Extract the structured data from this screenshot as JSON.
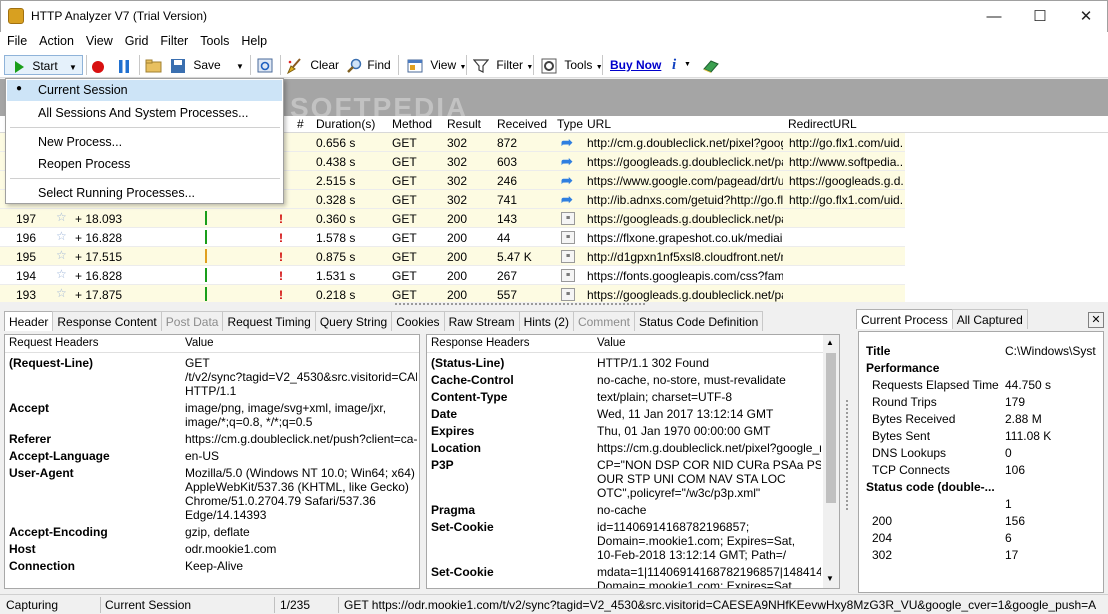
{
  "window": {
    "title": "HTTP Analyzer V7  (Trial Version)"
  },
  "menu": [
    "File",
    "Action",
    "View",
    "Grid",
    "Filter",
    "Tools",
    "Help"
  ],
  "toolbar": {
    "start": "Start",
    "save": "Save",
    "clear": "Clear",
    "find": "Find",
    "view": "View",
    "filter": "Filter",
    "tools": "Tools",
    "buy_now": "Buy Now"
  },
  "watermark": "SOFTPEDIA",
  "start_menu": {
    "items": [
      "Current Session",
      "All Sessions And System Processes...",
      "New Process...",
      "Reopen Process",
      "Select Running Processes..."
    ],
    "selected": "Current Session"
  },
  "grid": {
    "columns": [
      "#",
      "Duration(s)",
      "Method",
      "Result",
      "Received",
      "Type",
      "URL",
      "RedirectURL"
    ],
    "rows": [
      {
        "id": "",
        "offset": "",
        "duration": "0.656 s",
        "method": "GET",
        "result": "302",
        "received": "872",
        "url": "http://cm.g.doubleclick.net/pixel?googl...",
        "redirect": "http://go.flx1.com/uid..."
      },
      {
        "id": "",
        "offset": "",
        "duration": "0.438 s",
        "method": "GET",
        "result": "302",
        "received": "603",
        "url": "https://googleads.g.doubleclick.net/pa...",
        "redirect": "http://www.softpedia...."
      },
      {
        "id": "",
        "offset": "",
        "duration": "2.515 s",
        "method": "GET",
        "result": "302",
        "received": "246",
        "url": "https://www.google.com/pagead/drt/ui",
        "redirect": "https://googleads.g.d..."
      },
      {
        "id": "",
        "offset": "",
        "duration": "0.328 s",
        "method": "GET",
        "result": "302",
        "received": "741",
        "url": "http://ib.adnxs.com/getuid?http://go.fl...",
        "redirect": "http://go.flx1.com/uid..."
      },
      {
        "id": "197",
        "offset": "+ 18.093",
        "duration": "0.360 s",
        "method": "GET",
        "result": "200",
        "received": "143",
        "url": "https://googleads.g.doubleclick.net/pa...",
        "redirect": ""
      },
      {
        "id": "196",
        "offset": "+ 16.828",
        "duration": "1.578 s",
        "method": "GET",
        "result": "200",
        "received": "44",
        "url": "https://flxone.grapeshot.co.uk/mediain...",
        "redirect": ""
      },
      {
        "id": "195",
        "offset": "+ 17.515",
        "duration": "0.875 s",
        "method": "GET",
        "result": "200",
        "received": "5.47 K",
        "url": "http://d1gpxn1nf5xsl8.cloudfront.net/n...",
        "redirect": ""
      },
      {
        "id": "194",
        "offset": "+ 16.828",
        "duration": "1.531 s",
        "method": "GET",
        "result": "200",
        "received": "267",
        "url": "https://fonts.googleapis.com/css?famil...",
        "redirect": ""
      },
      {
        "id": "193",
        "offset": "+ 17.875",
        "duration": "0.218 s",
        "method": "GET",
        "result": "200",
        "received": "557",
        "url": "https://googleads.g.doubleclick.net/pa...",
        "redirect": ""
      }
    ]
  },
  "detail_tabs": [
    "Header",
    "Response Content",
    "Post Data",
    "Request Timing",
    "Query String",
    "Cookies",
    "Raw Stream",
    "Hints (2)",
    "Comment",
    "Status Code Definition"
  ],
  "request_headers": {
    "col1": "Request Headers",
    "col2": "Value",
    "rows": [
      {
        "k": "(Request-Line)",
        "v": [
          "GET",
          "/t/v2/sync?tagid=V2_4530&src.visitorid=CAESE...",
          "HTTP/1.1"
        ]
      },
      {
        "k": "Accept",
        "v": [
          "image/png, image/svg+xml, image/jxr,",
          "image/*;q=0.8, */*;q=0.5"
        ]
      },
      {
        "k": "Referer",
        "v": [
          "https://cm.g.doubleclick.net/push?client=ca-..."
        ]
      },
      {
        "k": "Accept-Language",
        "v": [
          "en-US"
        ]
      },
      {
        "k": "User-Agent",
        "v": [
          "Mozilla/5.0 (Windows NT 10.0; Win64; x64)",
          "AppleWebKit/537.36 (KHTML, like Gecko)",
          "Chrome/51.0.2704.79 Safari/537.36",
          "Edge/14.14393"
        ]
      },
      {
        "k": "Accept-Encoding",
        "v": [
          "gzip, deflate"
        ]
      },
      {
        "k": "Host",
        "v": [
          "odr.mookie1.com"
        ]
      },
      {
        "k": "Connection",
        "v": [
          "Keep-Alive"
        ]
      }
    ]
  },
  "response_headers": {
    "col1": "Response Headers",
    "col2": "Value",
    "rows": [
      {
        "k": "(Status-Line)",
        "v": [
          "HTTP/1.1 302 Found"
        ]
      },
      {
        "k": "Cache-Control",
        "v": [
          "no-cache, no-store, must-revalidate"
        ]
      },
      {
        "k": "Content-Type",
        "v": [
          "text/plain; charset=UTF-8"
        ]
      },
      {
        "k": "Date",
        "v": [
          "Wed, 11 Jan 2017 13:12:14 GMT"
        ]
      },
      {
        "k": "Expires",
        "v": [
          "Thu, 01 Jan 1970 00:00:00 GMT"
        ]
      },
      {
        "k": "Location",
        "v": [
          "https://cm.g.doubleclick.net/pixel?google_n..."
        ]
      },
      {
        "k": "P3P",
        "v": [
          "CP=\"NON DSP COR NID CURa PSAa PSDa",
          "OUR STP UNI COM NAV STA LOC",
          "OTC\",policyref=\"/w3c/p3p.xml\""
        ]
      },
      {
        "k": "Pragma",
        "v": [
          "no-cache"
        ]
      },
      {
        "k": "Set-Cookie",
        "v": [
          "id=1140691416878219685​7;",
          "Domain=.mookie1.com; Expires=Sat,",
          "10-Feb-2018 13:12:14 GMT; Path=/"
        ]
      },
      {
        "k": "Set-Cookie",
        "v": [
          "mdata=1|11406914168782196857|14841403...",
          "Domain=.mookie1.com; Expires=Sat,"
        ]
      }
    ]
  },
  "side_tabs": [
    "Current Process",
    "All Captured"
  ],
  "side_panel": {
    "title_label": "Title",
    "title_value": "C:\\Windows\\Syst",
    "performance": "Performance",
    "perf_rows": [
      {
        "k": "Requests Elapsed Time",
        "v": "44.750 s"
      },
      {
        "k": "Round Trips",
        "v": "179"
      },
      {
        "k": "Bytes Received",
        "v": "2.88 M"
      },
      {
        "k": "Bytes Sent",
        "v": "111.08 K"
      },
      {
        "k": "DNS Lookups",
        "v": "0"
      },
      {
        "k": "TCP Connects",
        "v": "106"
      }
    ],
    "status_code": "Status code (double-...",
    "status_rows": [
      {
        "k": "",
        "v": "1"
      },
      {
        "k": "200",
        "v": "156"
      },
      {
        "k": "204",
        "v": "6"
      },
      {
        "k": "302",
        "v": "17"
      }
    ]
  },
  "statusbar": {
    "state": "Capturing",
    "session": "Current Session",
    "count": "1/235",
    "request": "GET  https://odr.mookie1.com/t/v2/sync?tagid=V2_4530&src.visitorid=CAESEA9NHfKEevwHxy8MzG3R_VU&google_cver=1&google_push=A"
  }
}
